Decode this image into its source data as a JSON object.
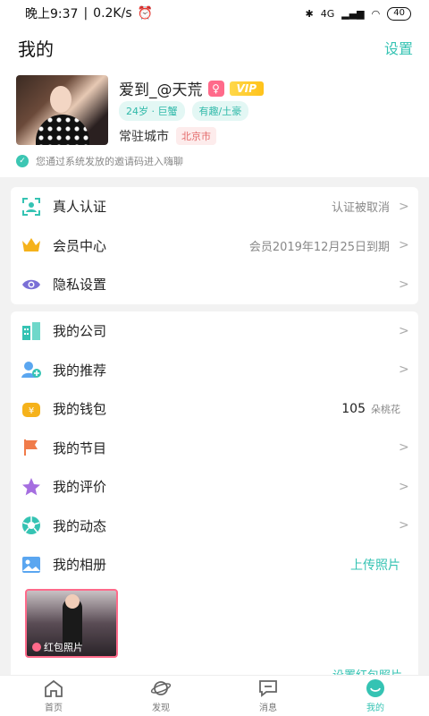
{
  "status_bar": {
    "time": "晚上9:37",
    "speed": "0.2K/s",
    "network": "4G",
    "battery": "40"
  },
  "header": {
    "title": "我的",
    "settings_label": "设置"
  },
  "profile": {
    "nickname": "爱到_@天荒",
    "gender": "♀",
    "vip_label": "VIP",
    "tags": [
      "24岁 · 巨蟹",
      "有趣/土豪"
    ],
    "city_label": "常驻城市",
    "city_value": "北京市",
    "invite_text": "您通过系统发放的邀请码进入嗨聊"
  },
  "menu_group1": [
    {
      "label": "真人认证",
      "value": "认证被取消",
      "icon": "face-scan-icon",
      "color": "#35c3b3"
    },
    {
      "label": "会员中心",
      "value": "会员2019年12月25日到期",
      "icon": "crown-icon",
      "color": "#f5b21b"
    },
    {
      "label": "隐私设置",
      "value": "",
      "icon": "eye-icon",
      "color": "#7a6fd6"
    }
  ],
  "menu_group2": [
    {
      "label": "我的公司",
      "icon": "building-icon",
      "color": "#35c3b3"
    },
    {
      "label": "我的推荐",
      "icon": "add-user-icon",
      "color": "#5aa6f0"
    },
    {
      "label": "我的钱包",
      "value": "105",
      "unit": "朵桃花",
      "icon": "wallet-icon",
      "color": "#f5b21b"
    },
    {
      "label": "我的节目",
      "icon": "flag-icon",
      "color": "#f07b4a"
    },
    {
      "label": "我的评价",
      "icon": "star-icon",
      "color": "#a56ee0"
    },
    {
      "label": "我的动态",
      "icon": "shutter-icon",
      "color": "#35c3b3"
    },
    {
      "label": "我的相册",
      "action": "上传照片",
      "icon": "album-icon",
      "color": "#5aa6f0"
    }
  ],
  "album": {
    "photo_label": "红包照片",
    "set_link": "设置红包照片"
  },
  "tabbar": [
    {
      "label": "首页",
      "icon": "home-icon"
    },
    {
      "label": "发现",
      "icon": "planet-icon"
    },
    {
      "label": "消息",
      "icon": "message-icon"
    },
    {
      "label": "我的",
      "icon": "smile-icon",
      "active": true
    }
  ],
  "colors": {
    "accent": "#35c3b3",
    "pink": "#ff6a8a",
    "gold": "#f5b21b"
  }
}
